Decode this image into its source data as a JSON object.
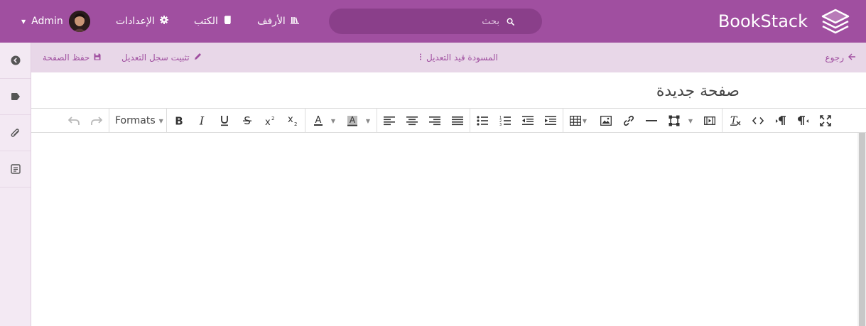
{
  "header": {
    "app_name": "BookStack",
    "search_placeholder": "بحث",
    "nav": {
      "shelves": "الأرفف",
      "books": "الكتب",
      "settings": "الإعدادات"
    },
    "user": {
      "name": "Admin"
    },
    "colors": {
      "primary": "#a04fa0"
    }
  },
  "editbar": {
    "back": "رجوع",
    "draft_status": "المسودة قيد التعديل",
    "pin_revision": "تثبيت سجل التعديل",
    "save_page": "حفظ الصفحة"
  },
  "page": {
    "title": "صفحة جديدة"
  },
  "toolbar": {
    "formats_label": "Formats"
  },
  "sidebar": {
    "icons": [
      "info-circle-icon",
      "tag-icon",
      "paperclip-icon",
      "template-icon"
    ]
  }
}
